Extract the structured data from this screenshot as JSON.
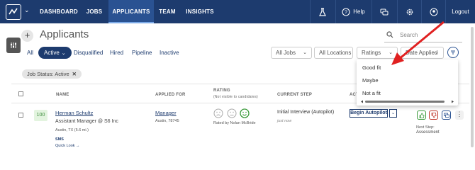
{
  "nav": {
    "links": [
      "DASHBOARD",
      "JOBS",
      "APPLICANTS",
      "TEAM",
      "INSIGHTS"
    ],
    "active": "APPLICANTS",
    "help": "Help",
    "logout": "Logout"
  },
  "page": {
    "title": "Applicants",
    "search_placeholder": "Search"
  },
  "status_tabs": {
    "all": "All",
    "active": "Active",
    "disqualified": "Disqualified",
    "hired": "Hired",
    "pipeline": "Pipeline",
    "inactive": "Inactive"
  },
  "filters": {
    "jobs": "All Jobs",
    "locations": "All Locations",
    "ratings": "Ratings",
    "sort": "Date Applied"
  },
  "chip": {
    "label": "Job Status: Active",
    "remove": "✕"
  },
  "table": {
    "headers": {
      "name": "NAME",
      "applied_for": "APPLIED FOR",
      "rating": "RATING",
      "rating_note": "(Not visible to candidates)",
      "current_step": "CURRENT STEP",
      "actions": "ACT"
    },
    "row": {
      "score": "100",
      "name": "Herman Schultz",
      "title": "Assistant Manager @ S6 Inc",
      "location": "Austin, TX (5.6 mi.)",
      "sms": "SMS",
      "quick_look": "Quick Look →",
      "applied_job": "Manager",
      "applied_location": "Austin, 78745",
      "rated_by": "Rated by Nolan McBride",
      "step": "Initial Interview (Autopilot)",
      "step_time": "just now",
      "begin_button": "Begin Autopilot",
      "next_step_label": "Next Step:",
      "next_step_value": "Assessment"
    }
  },
  "ratings_dropdown": {
    "options": [
      "Good fit",
      "Maybe",
      "Not a fit"
    ]
  },
  "colors": {
    "nav_bg": "#1d3b6e",
    "nav_active": "#2a5292",
    "accent": "#1d3b6e",
    "good": "#3a9a3a",
    "bad": "#c0392b",
    "arrow": "#e02020"
  }
}
